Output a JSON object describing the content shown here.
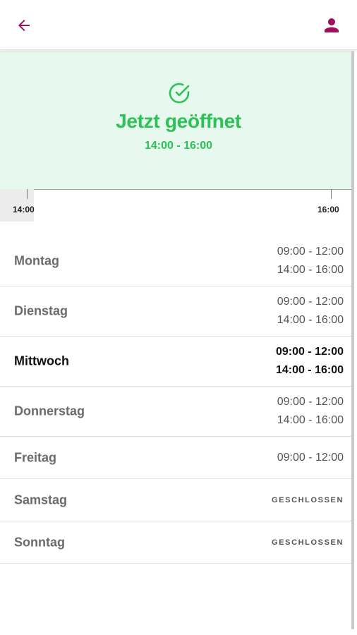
{
  "header": {
    "back_icon": "arrow-left-icon",
    "profile_icon": "person-icon",
    "accent_color": "#9c1157"
  },
  "status": {
    "icon": "check-circle-icon",
    "title": "Jetzt geöffnet",
    "time_range": "14:00 - 16:00",
    "color": "#2dc255",
    "background": "#e7f9ef"
  },
  "timeline": {
    "start_label": "14:00",
    "end_label": "16:00"
  },
  "days": [
    {
      "name": "Montag",
      "hours": [
        "09:00 - 12:00",
        "14:00 - 16:00"
      ]
    },
    {
      "name": "Dienstag",
      "hours": [
        "09:00 - 12:00",
        "14:00 - 16:00"
      ]
    },
    {
      "name": "Mittwoch",
      "hours": [
        "09:00 - 12:00",
        "14:00 - 16:00"
      ],
      "today": true
    },
    {
      "name": "Donnerstag",
      "hours": [
        "09:00 - 12:00",
        "14:00 - 16:00"
      ]
    },
    {
      "name": "Freitag",
      "hours": [
        "09:00 - 12:00"
      ]
    },
    {
      "name": "Samstag",
      "closed_label": "GESCHLOSSEN"
    },
    {
      "name": "Sonntag",
      "closed_label": "GESCHLOSSEN"
    }
  ]
}
